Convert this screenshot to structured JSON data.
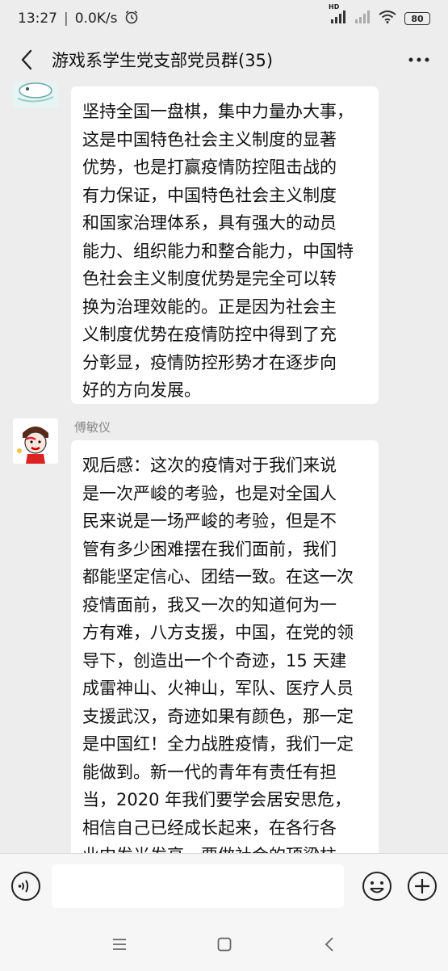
{
  "status": {
    "time": "13:27",
    "network_speed": "0.0K/s",
    "battery": "80",
    "network_type": "HD"
  },
  "header": {
    "title": "游戏系学生党支部党员群(35)"
  },
  "messages": [
    {
      "sender": "",
      "text": "坚持全国一盘棋，集中力量办大事，\n这是中国特色社会主义制度的显著\n优势，也是打赢疫情防控阻击战的\n有力保证，中国特色社会主义制度\n和国家治理体系，具有强大的动员\n能力、组织能力和整合能力，中国特\n色社会主义制度优势是完全可以转\n换为治理效能的。正是因为社会主\n义制度优势在疫情防控中得到了充\n分彰显，疫情防控形势才在逐步向\n好的方向发展。"
    },
    {
      "sender": "傅敏仪",
      "text": "观后感：这次的疫情对于我们来说\n是一次严峻的考验，也是对全国人\n民来说是一场严峻的考验，但是不\n管有多少困难摆在我们面前，我们\n都能坚定信心、团结一致。在这一次\n疫情面前，我又一次的知道何为一\n方有难，八方支援，中国，在党的领\n导下，创造出一个个奇迹，15 天建\n成雷神山、火神山，军队、医疗人员\n支援武汉，奇迹如果有颜色，那一定\n是中国红！全力战胜疫情，我们一定\n能做到。新一代的青年有责任有担\n当，2020 年我们要学会居安思危，\n相信自己已经成长起来，在各行各\n业中发光发亮，要做社会的顶梁柱。"
    }
  ],
  "input": {
    "value": ""
  },
  "icons": {
    "back": "back-arrow-icon",
    "more": "more-icon",
    "voice": "voice-icon",
    "emoji": "emoji-icon",
    "plus": "plus-icon",
    "nav_menu": "menu-icon",
    "nav_home": "home-icon",
    "nav_back": "back-icon"
  },
  "colors": {
    "background": "#ededed",
    "bubble": "#ffffff",
    "bar": "#f6f6f6"
  }
}
